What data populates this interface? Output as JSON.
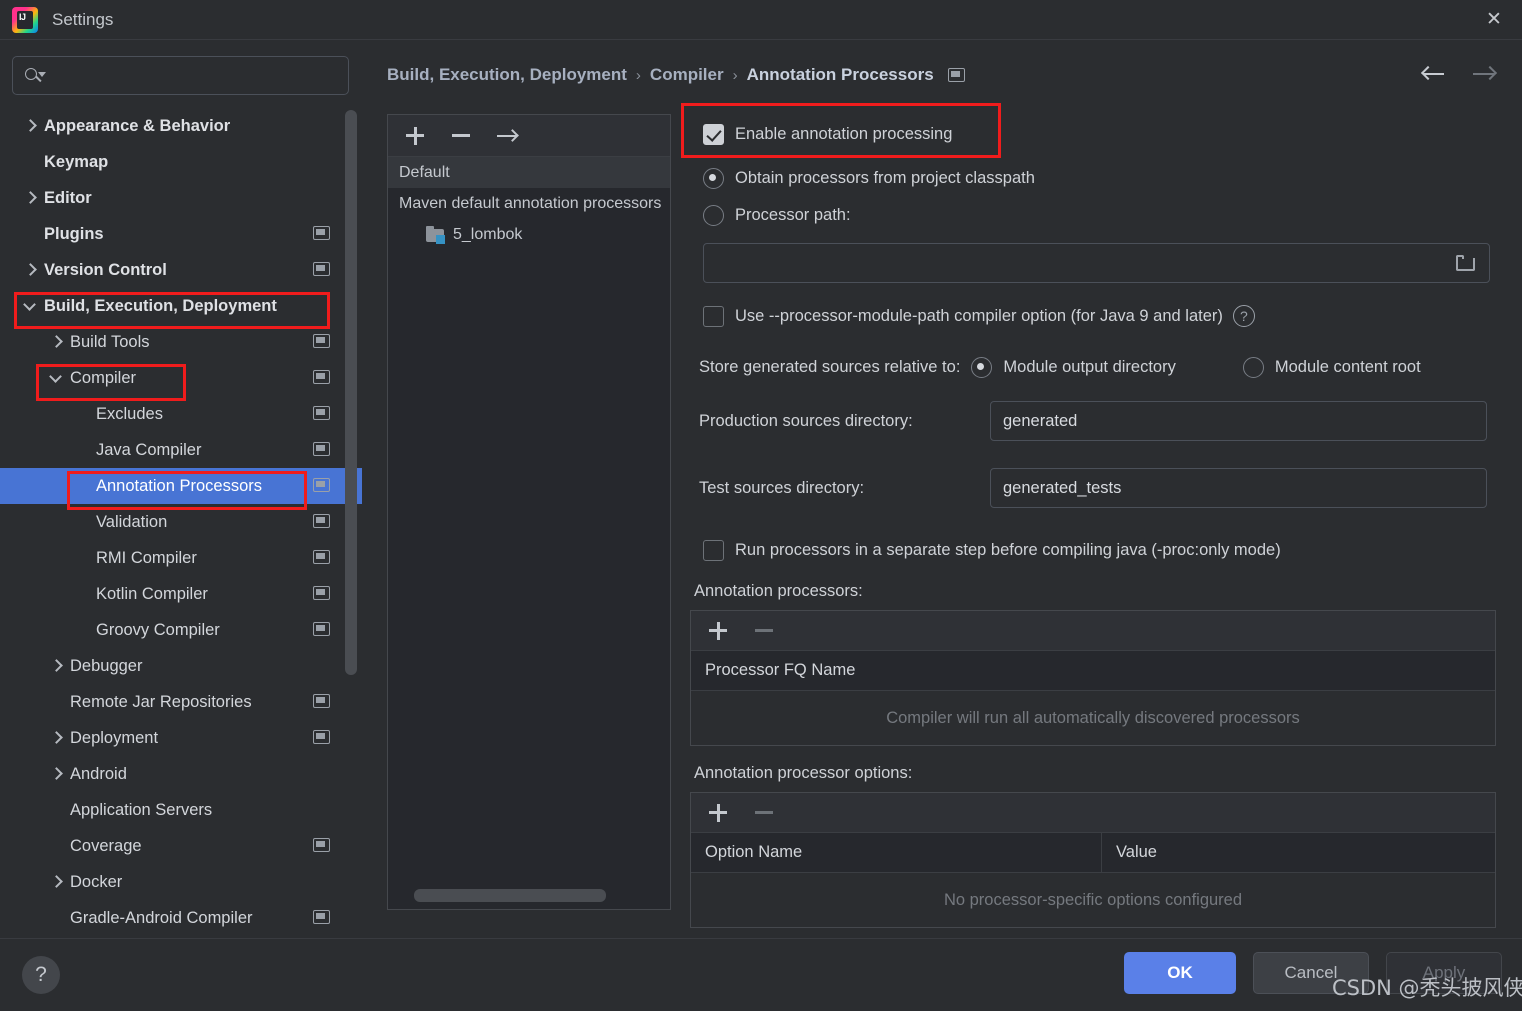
{
  "window": {
    "title": "Settings",
    "logo_icon": "intellij-idea-logo",
    "close_icon": "close-icon"
  },
  "search": {
    "icon": "search-icon",
    "value": "",
    "placeholder": ""
  },
  "sidebar": {
    "items": [
      {
        "label": "Appearance & Behavior",
        "arrow": "chevron-right-icon",
        "indent": 0,
        "bold": true,
        "cfg": false,
        "selected": false
      },
      {
        "label": "Keymap",
        "arrow": "none",
        "indent": 0,
        "bold": true,
        "cfg": false,
        "selected": false
      },
      {
        "label": "Editor",
        "arrow": "chevron-right-icon",
        "indent": 0,
        "bold": true,
        "cfg": false,
        "selected": false
      },
      {
        "label": "Plugins",
        "arrow": "none",
        "indent": 0,
        "bold": true,
        "cfg": true,
        "selected": false
      },
      {
        "label": "Version Control",
        "arrow": "chevron-right-icon",
        "indent": 0,
        "bold": true,
        "cfg": true,
        "selected": false
      },
      {
        "label": "Build, Execution, Deployment",
        "arrow": "chevron-down-icon",
        "indent": 0,
        "bold": true,
        "cfg": false,
        "selected": false
      },
      {
        "label": "Build Tools",
        "arrow": "chevron-right-icon",
        "indent": 1,
        "bold": false,
        "cfg": true,
        "selected": false
      },
      {
        "label": "Compiler",
        "arrow": "chevron-down-icon",
        "indent": 1,
        "bold": false,
        "cfg": true,
        "selected": false
      },
      {
        "label": "Excludes",
        "arrow": "none",
        "indent": 2,
        "bold": false,
        "cfg": true,
        "selected": false
      },
      {
        "label": "Java Compiler",
        "arrow": "none",
        "indent": 2,
        "bold": false,
        "cfg": true,
        "selected": false
      },
      {
        "label": "Annotation Processors",
        "arrow": "none",
        "indent": 2,
        "bold": false,
        "cfg": true,
        "selected": true
      },
      {
        "label": "Validation",
        "arrow": "none",
        "indent": 2,
        "bold": false,
        "cfg": true,
        "selected": false
      },
      {
        "label": "RMI Compiler",
        "arrow": "none",
        "indent": 2,
        "bold": false,
        "cfg": true,
        "selected": false
      },
      {
        "label": "Kotlin Compiler",
        "arrow": "none",
        "indent": 2,
        "bold": false,
        "cfg": true,
        "selected": false
      },
      {
        "label": "Groovy Compiler",
        "arrow": "none",
        "indent": 2,
        "bold": false,
        "cfg": true,
        "selected": false
      },
      {
        "label": "Debugger",
        "arrow": "chevron-right-icon",
        "indent": 1,
        "bold": false,
        "cfg": false,
        "selected": false
      },
      {
        "label": "Remote Jar Repositories",
        "arrow": "none",
        "indent": 1,
        "bold": false,
        "cfg": true,
        "selected": false
      },
      {
        "label": "Deployment",
        "arrow": "chevron-right-icon",
        "indent": 1,
        "bold": false,
        "cfg": true,
        "selected": false
      },
      {
        "label": "Android",
        "arrow": "chevron-right-icon",
        "indent": 1,
        "bold": false,
        "cfg": false,
        "selected": false
      },
      {
        "label": "Application Servers",
        "arrow": "none",
        "indent": 1,
        "bold": false,
        "cfg": false,
        "selected": false
      },
      {
        "label": "Coverage",
        "arrow": "none",
        "indent": 1,
        "bold": false,
        "cfg": true,
        "selected": false
      },
      {
        "label": "Docker",
        "arrow": "chevron-right-icon",
        "indent": 1,
        "bold": false,
        "cfg": false,
        "selected": false
      },
      {
        "label": "Gradle-Android Compiler",
        "arrow": "none",
        "indent": 1,
        "bold": false,
        "cfg": true,
        "selected": false
      }
    ]
  },
  "breadcrumb": {
    "crumbs": [
      "Build, Execution, Deployment",
      "Compiler",
      "Annotation Processors"
    ],
    "separator": "›",
    "trailing_icon": "module-config-icon",
    "back_icon": "arrow-left-icon",
    "forward_icon": "arrow-right-icon"
  },
  "module_panel": {
    "toolbar": {
      "add_icon": "plus-icon",
      "remove_icon": "minus-icon",
      "move_icon": "arrow-right-icon"
    },
    "rows": [
      {
        "label": "Default",
        "indent": 0,
        "selected": true,
        "icon": "none"
      },
      {
        "label": "Maven default annotation processors",
        "indent": 0,
        "selected": false,
        "icon": "none"
      },
      {
        "label": "5_lombok",
        "indent": 1,
        "selected": false,
        "icon": "module-folder-icon"
      }
    ]
  },
  "settings": {
    "enable_annotation_processing": {
      "label": "Enable annotation processing",
      "checked": true,
      "highlighted": true
    },
    "source_mode": {
      "options": [
        {
          "label": "Obtain processors from project classpath",
          "selected": true
        },
        {
          "label": "Processor path:",
          "selected": false
        }
      ]
    },
    "processor_path": {
      "value": "",
      "browse_icon": "folder-open-icon"
    },
    "use_module_path": {
      "label": "Use --processor-module-path compiler option (for Java 9 and later)",
      "checked": false,
      "help_icon": "help-circle-icon"
    },
    "store_relative": {
      "label": "Store generated sources relative to:",
      "options": [
        {
          "label": "Module output directory",
          "selected": true
        },
        {
          "label": "Module content root",
          "selected": false
        }
      ]
    },
    "production_sources": {
      "label": "Production sources directory:",
      "value": "generated"
    },
    "test_sources": {
      "label": "Test sources directory:",
      "value": "generated_tests"
    },
    "separate_step": {
      "label": "Run processors in a separate step before compiling java (-proc:only mode)",
      "checked": false
    },
    "processors_table": {
      "label": "Annotation processors:",
      "add_icon": "plus-icon",
      "remove_icon": "minus-icon",
      "columns": [
        "Processor FQ Name"
      ],
      "rows": [],
      "empty_text": "Compiler will run all automatically discovered processors"
    },
    "options_table": {
      "label": "Annotation processor options:",
      "add_icon": "plus-icon",
      "remove_icon": "minus-icon",
      "columns": [
        "Option Name",
        "Value"
      ],
      "rows": [],
      "empty_text": "No processor-specific options configured"
    }
  },
  "footer": {
    "help_label": "?",
    "help_icon": "help-icon",
    "ok_label": "OK",
    "cancel_label": "Cancel",
    "apply_label": "Apply"
  },
  "watermark": {
    "text": "CSDN @秃头披风侠."
  },
  "colors": {
    "accent_blue": "#5a80e8",
    "selection_blue": "#4874d4",
    "highlight_red": "#f01c1c",
    "background": "#2b2d30"
  }
}
